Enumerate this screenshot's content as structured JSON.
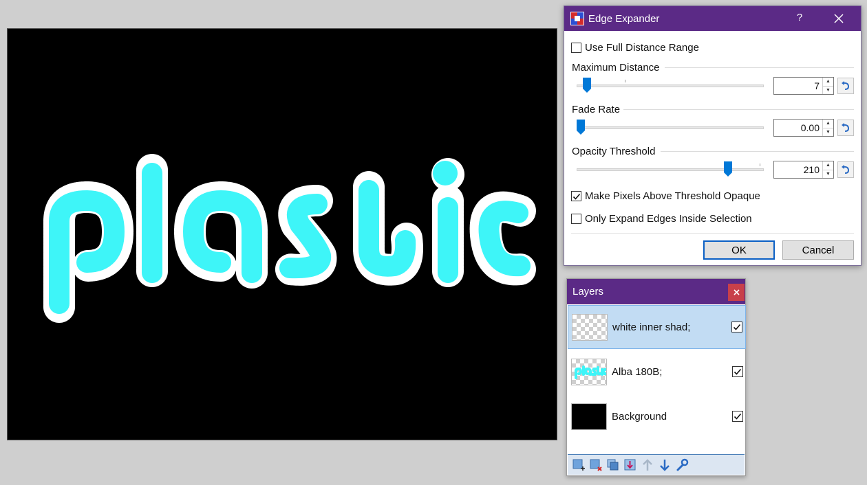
{
  "canvas": {
    "artwork_text": "plastic",
    "background_color": "#000000",
    "text_color": "#3ef5f8",
    "outline_color": "#ffffff"
  },
  "dialog": {
    "title": "Edge Expander",
    "help_label": "?",
    "icon": "edge-expander-app-icon",
    "use_full_distance_range": {
      "label": "Use Full Distance Range",
      "checked": false
    },
    "maximum_distance": {
      "label": "Maximum Distance",
      "value": "7",
      "slider_fraction": 0.05
    },
    "fade_rate": {
      "label": "Fade Rate",
      "value": "0.00",
      "slider_fraction": 0.0
    },
    "opacity_threshold": {
      "label": "Opacity Threshold",
      "value": "210",
      "slider_fraction": 0.82
    },
    "make_pixels_opaque": {
      "label": "Make Pixels Above Threshold Opaque",
      "checked": true
    },
    "only_expand_inside_selection": {
      "label": "Only Expand Edges Inside Selection",
      "checked": false
    },
    "ok_label": "OK",
    "cancel_label": "Cancel",
    "accent_color": "#0078d7",
    "title_bar_color": "#5b2a86"
  },
  "layers": {
    "title": "Layers",
    "items": [
      {
        "name": "white inner shad;",
        "visible": true,
        "selected": true,
        "thumb": "transparent"
      },
      {
        "name": "Alba 180B;",
        "visible": true,
        "selected": false,
        "thumb": "plastic-text"
      },
      {
        "name": "Background",
        "visible": true,
        "selected": false,
        "thumb": "black"
      }
    ],
    "toolbar": [
      "add-layer-icon",
      "delete-layer-icon",
      "duplicate-layer-icon",
      "merge-layer-down-icon",
      "move-layer-up-icon",
      "move-layer-down-icon",
      "layer-properties-icon"
    ]
  }
}
